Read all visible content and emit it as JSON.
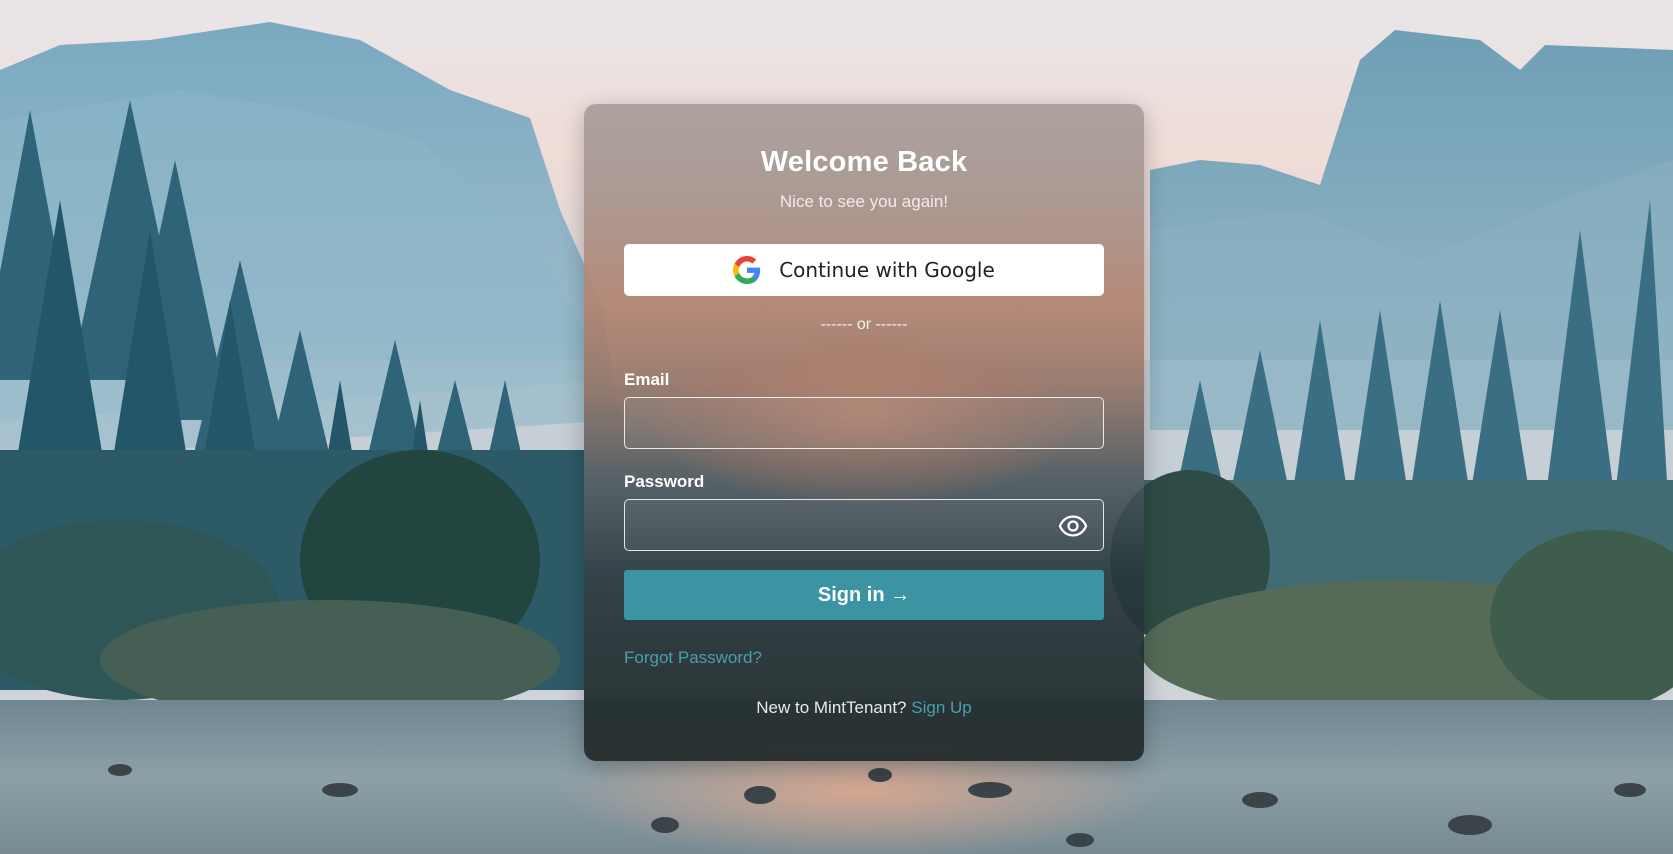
{
  "login": {
    "title": "Welcome Back",
    "subtitle": "Nice to see you again!",
    "google_button_label": "Continue with Google",
    "divider_text": "------ or ------",
    "email_label": "Email",
    "email_value": "",
    "password_label": "Password",
    "password_value": "",
    "signin_label": "Sign in →",
    "forgot_password_label": "Forgot Password?",
    "signup_prompt": "New to MintTenant?",
    "signup_link_label": "Sign Up"
  },
  "icons": {
    "google": "google-icon",
    "password_toggle": "eye-icon"
  },
  "colors": {
    "accent": "#3c93a2",
    "link": "#49a0ae",
    "card_text": "#ffffff",
    "google_button_bg": "#ffffff"
  }
}
